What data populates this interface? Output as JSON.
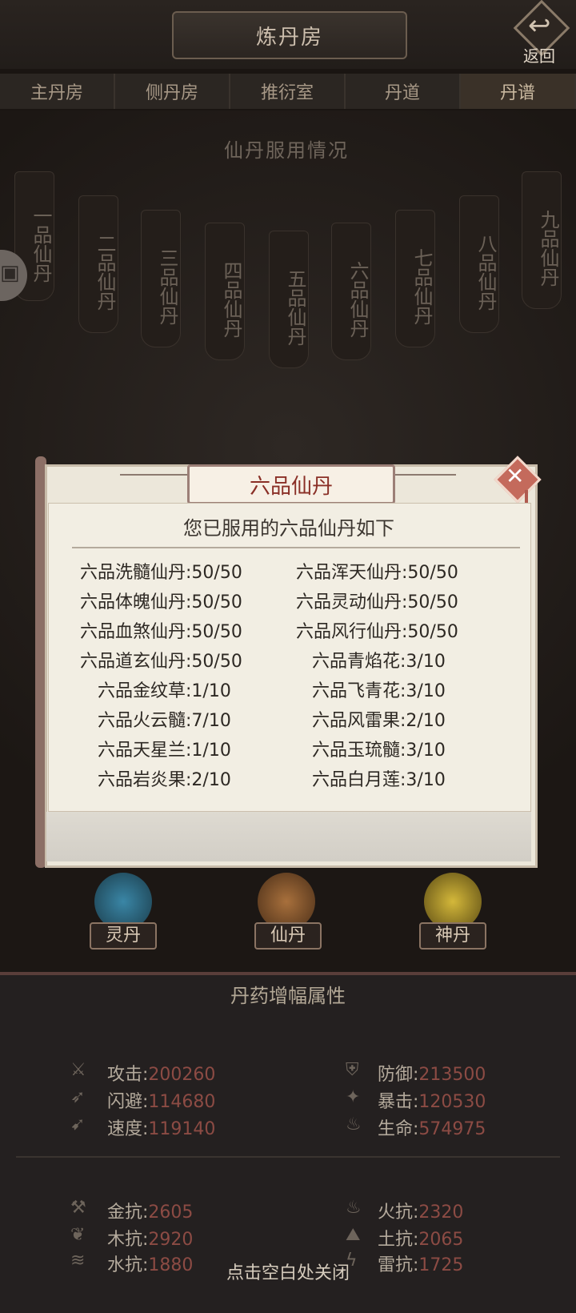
{
  "header": {
    "title": "炼丹房",
    "back_label": "返回"
  },
  "tabs": [
    "主丹房",
    "侧丹房",
    "推衍室",
    "丹道",
    "丹谱"
  ],
  "background": {
    "section_title": "仙丹服用情况",
    "grades": [
      "一品仙丹",
      "二品仙丹",
      "三品仙丹",
      "四品仙丹",
      "五品仙丹",
      "六品仙丹",
      "七品仙丹",
      "八品仙丹",
      "九品仙丹"
    ]
  },
  "modal": {
    "title": "六品仙丹",
    "subtitle": "您已服用的六品仙丹如下",
    "items": [
      [
        "六品洗髓仙丹:50/50",
        "六品浑天仙丹:50/50"
      ],
      [
        "六品体魄仙丹:50/50",
        "六品灵动仙丹:50/50"
      ],
      [
        "六品血煞仙丹:50/50",
        "六品风行仙丹:50/50"
      ],
      [
        "六品道玄仙丹:50/50",
        "六品青焰花:3/10"
      ],
      [
        "六品金纹草:1/10",
        "六品飞青花:3/10"
      ],
      [
        "六品火云髓:7/10",
        "六品风雷果:2/10"
      ],
      [
        "六品天星兰:1/10",
        "六品玉琉髓:3/10"
      ],
      [
        "六品岩炎果:2/10",
        "六品白月莲:3/10"
      ]
    ]
  },
  "bottom_buttons": [
    "灵丹",
    "仙丹",
    "神丹"
  ],
  "panel": {
    "title": "丹药增幅属性",
    "stats": [
      {
        "label": "攻击:",
        "value": "200260",
        "icon": "sword-icon"
      },
      {
        "label": "防御:",
        "value": "213500",
        "icon": "armor-icon"
      },
      {
        "label": "闪避:",
        "value": "114680",
        "icon": "dodge-icon"
      },
      {
        "label": "暴击:",
        "value": "120530",
        "icon": "crit-icon"
      },
      {
        "label": "速度:",
        "value": "119140",
        "icon": "speed-icon"
      },
      {
        "label": "生命:",
        "value": "574975",
        "icon": "life-icon"
      }
    ],
    "resists": [
      {
        "label": "金抗:",
        "value": "2605",
        "icon": "metal-icon"
      },
      {
        "label": "火抗:",
        "value": "2320",
        "icon": "fire-icon"
      },
      {
        "label": "木抗:",
        "value": "2920",
        "icon": "wood-icon"
      },
      {
        "label": "土抗:",
        "value": "2065",
        "icon": "earth-icon"
      },
      {
        "label": "水抗:",
        "value": "1880",
        "icon": "water-icon"
      },
      {
        "label": "雷抗:",
        "value": "1725",
        "icon": "thunder-icon"
      }
    ],
    "close_hint": "点击空白处关闭"
  },
  "colors": {
    "accent_red": "#8a2f26",
    "stat_value": "#8c4b44",
    "orb_blue": "#2f6f8c",
    "orb_orange": "#8c5a2f",
    "orb_gold": "#b79a2f"
  }
}
